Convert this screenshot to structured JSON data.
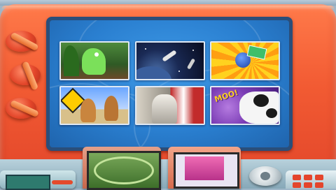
{
  "screen": {
    "thumbnails": [
      {
        "id": "dinosaur",
        "scene": "dinosaur-jungle"
      },
      {
        "id": "space",
        "scene": "space-shuttle"
      },
      {
        "id": "planet-toy",
        "scene": "sunburst-character"
      },
      {
        "id": "kangaroos",
        "scene": "kangaroo-crossing"
      },
      {
        "id": "lincoln",
        "scene": "lincoln-memorial"
      },
      {
        "id": "cow",
        "scene": "cow-moo",
        "caption": "MOO!"
      }
    ]
  },
  "colors": {
    "frame": "#f25b33",
    "screen": "#2a7fd0",
    "thumb_border": "#dfe9f5"
  }
}
